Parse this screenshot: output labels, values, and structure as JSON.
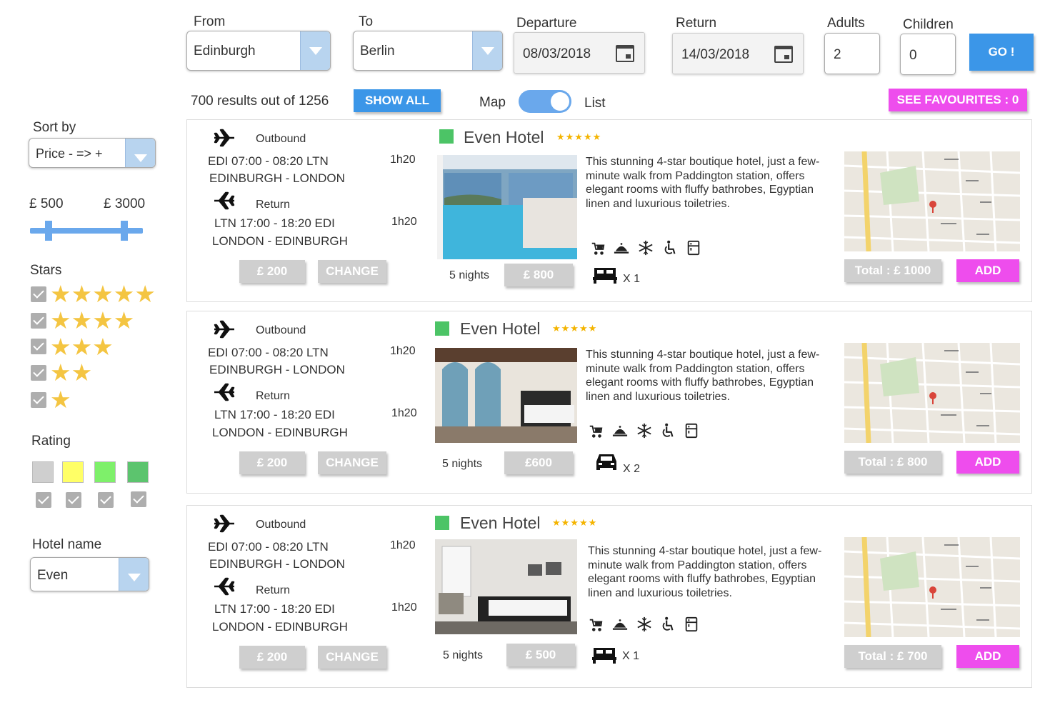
{
  "search": {
    "from_label": "From",
    "from_value": "Edinburgh",
    "to_label": "To",
    "to_value": "Berlin",
    "departure_label": "Departure",
    "departure_value": "08/03/2018",
    "return_label": "Return",
    "return_value": "14/03/2018",
    "adults_label": "Adults",
    "adults_value": "2",
    "children_label": "Children",
    "children_value": "0",
    "go_label": "GO !"
  },
  "results_bar": {
    "count_text": "700 results out of 1256",
    "show_all_label": "SHOW ALL",
    "map_label": "Map",
    "list_label": "List",
    "favourites_label": "SEE FAVOURITES : 0"
  },
  "sidebar": {
    "sort_label": "Sort by",
    "sort_value": "Price - => +",
    "price_min": "£ 500",
    "price_max": "£ 3000",
    "stars_label": "Stars",
    "star_rows": [
      "★★★★★",
      "★★★★",
      "★★★",
      "★★",
      "★"
    ],
    "rating_label": "Rating",
    "rating_colors": [
      "#cfcfcf",
      "#ffff66",
      "#7ef06a",
      "#5cc46e"
    ],
    "hotel_name_label": "Hotel name",
    "hotel_name_value": "Even"
  },
  "results": [
    {
      "outbound_label": "Outbound",
      "outbound_times": "EDI 07:00 - 08:20 LTN",
      "outbound_duration": "1h20",
      "outbound_route": "EDINBURGH - LONDON",
      "return_label": "Return",
      "return_times": "LTN 17:00 - 18:20 EDI",
      "return_duration": "1h20",
      "return_route": "LONDON - EDINBURGH",
      "flight_price": "£ 200",
      "change_label": "CHANGE",
      "hotel_name": "Even Hotel",
      "hotel_stars": "★★★★★",
      "nights": "5 nights",
      "hotel_price": "£ 800",
      "description": "This stunning 4-star boutique hotel, just a few-minute walk from Paddington station, offers elegant rooms with fluffy bathrobes, Egyptian linen and luxurious toiletries.",
      "beds": "X 1",
      "total": "Total : £ 1000",
      "add_label": "ADD"
    },
    {
      "outbound_label": "Outbound",
      "outbound_times": "EDI 07:00 - 08:20 LTN",
      "outbound_duration": "1h20",
      "outbound_route": "EDINBURGH - LONDON",
      "return_label": "Return",
      "return_times": "LTN 17:00 - 18:20 EDI",
      "return_duration": "1h20",
      "return_route": "LONDON - EDINBURGH",
      "flight_price": "£ 200",
      "change_label": "CHANGE",
      "hotel_name": "Even Hotel",
      "hotel_stars": "★★★★★",
      "nights": "5 nights",
      "hotel_price": "£600",
      "description": "This stunning 4-star boutique hotel, just a few-minute walk from Paddington station, offers elegant rooms with fluffy bathrobes, Egyptian linen and luxurious toiletries.",
      "beds": "X 2",
      "total": "Total : £ 800",
      "add_label": "ADD"
    },
    {
      "outbound_label": "Outbound",
      "outbound_times": "EDI 07:00 - 08:20 LTN",
      "outbound_duration": "1h20",
      "outbound_route": "EDINBURGH - LONDON",
      "return_label": "Return",
      "return_times": "LTN 17:00 - 18:20 EDI",
      "return_duration": "1h20",
      "return_route": "LONDON - EDINBURGH",
      "flight_price": "£ 200",
      "change_label": "CHANGE",
      "hotel_name": "Even Hotel",
      "hotel_stars": "★★★★★",
      "nights": "5 nights",
      "hotel_price": "£ 500",
      "description": "This stunning 4-star boutique hotel, just a few-minute walk from Paddington station, offers elegant rooms with fluffy bathrobes, Egyptian linen and luxurious toiletries.",
      "beds": "X 1",
      "total": "Total : £ 700",
      "add_label": "ADD"
    }
  ]
}
